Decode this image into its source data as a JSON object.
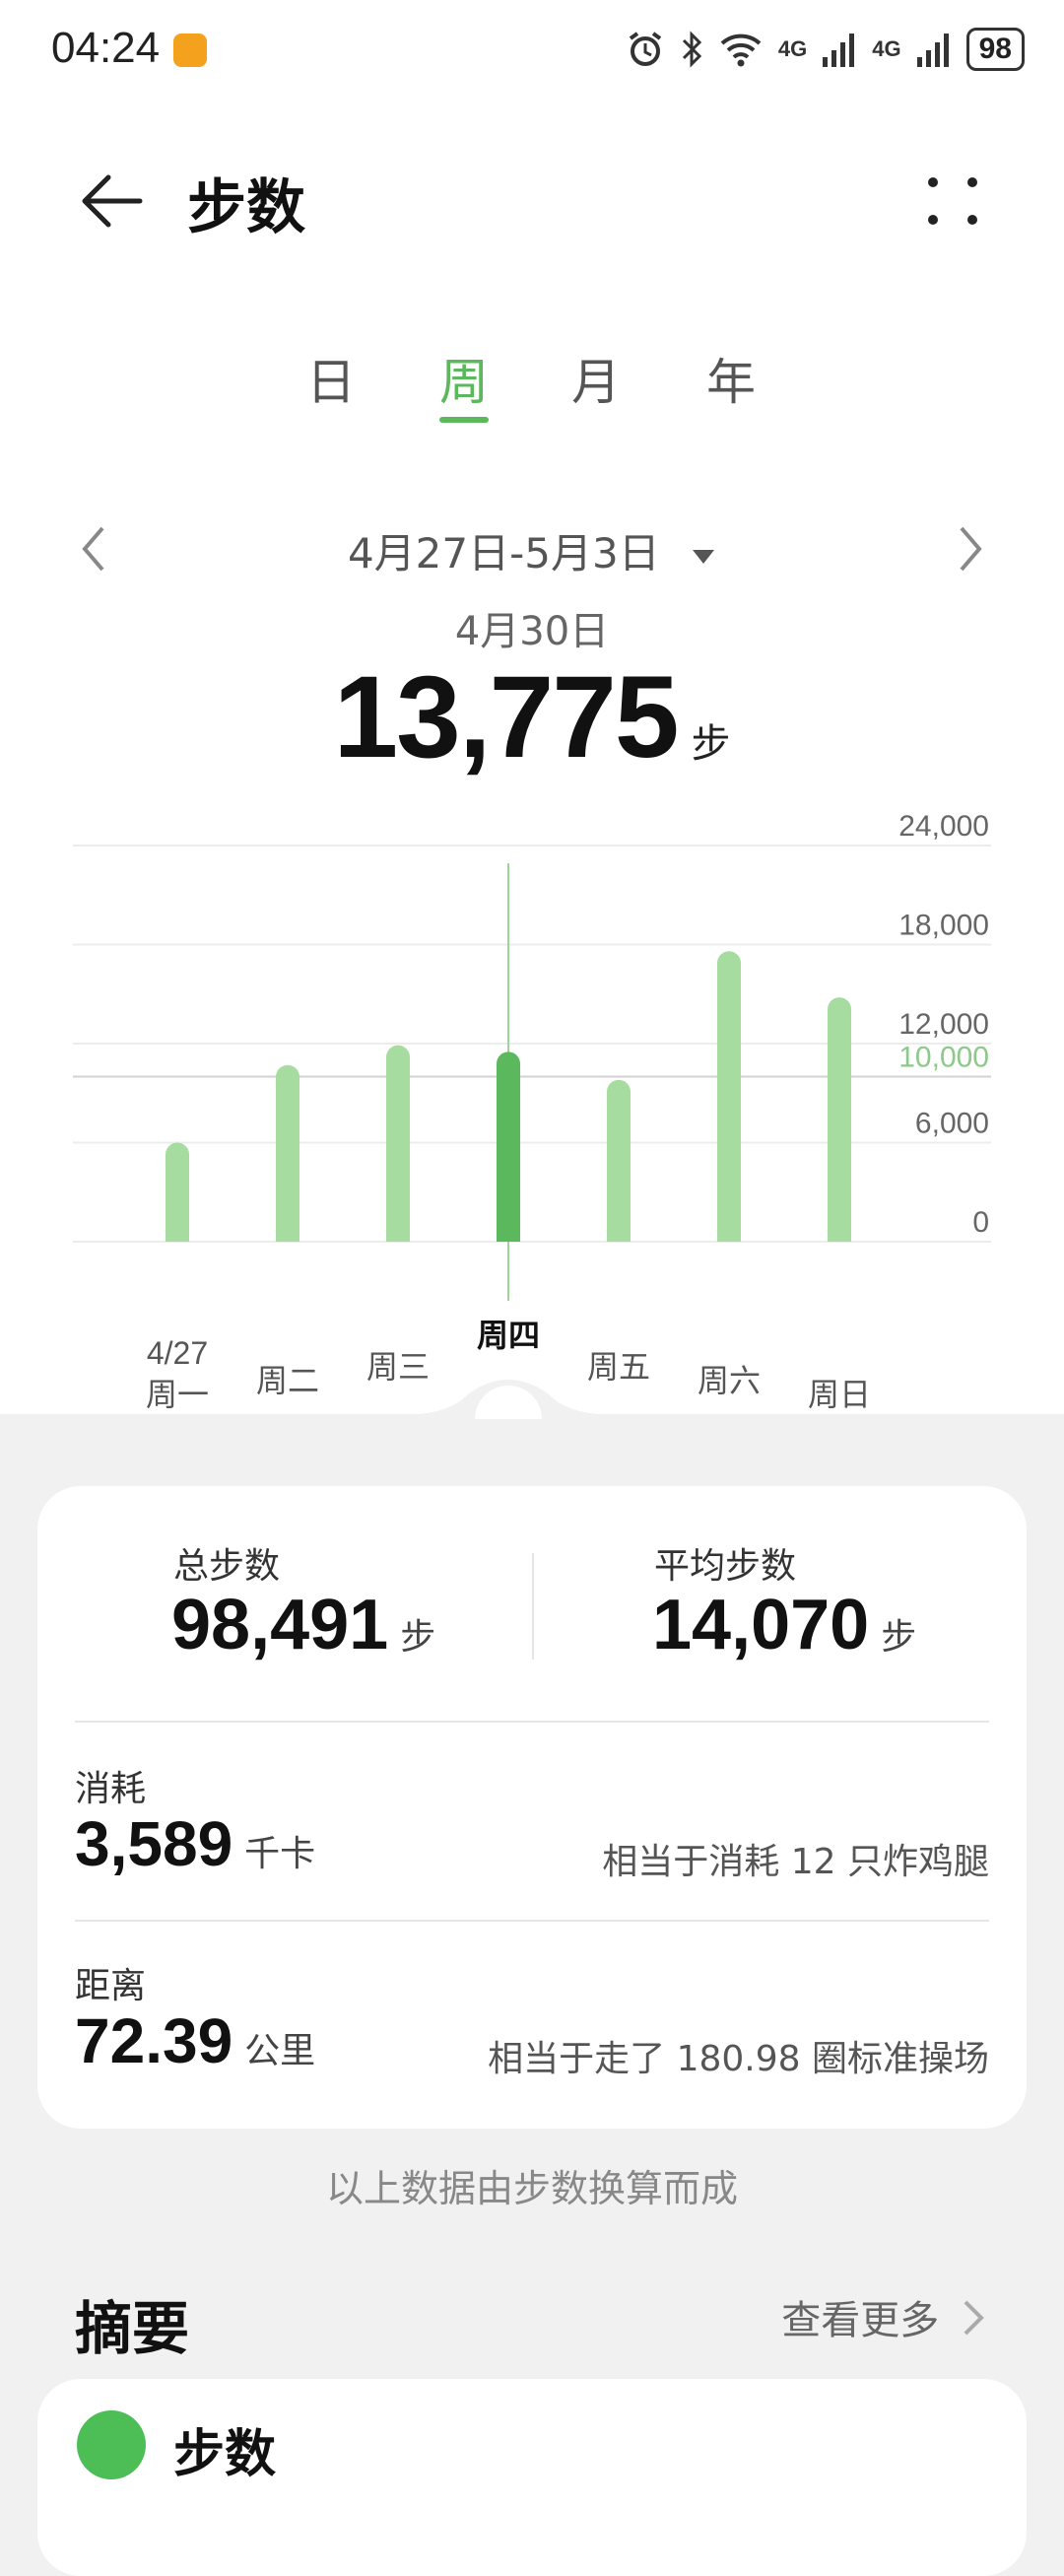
{
  "status": {
    "time": "04:24",
    "battery": "98",
    "net1": "4G",
    "net2": "4G"
  },
  "header": {
    "title": "步数"
  },
  "tabs": [
    {
      "label": "日"
    },
    {
      "label": "周"
    },
    {
      "label": "月"
    },
    {
      "label": "年"
    }
  ],
  "active_tab": 1,
  "range": {
    "label": "4月27日-5月3日"
  },
  "selected": {
    "date": "4月30日",
    "value": "13,775",
    "unit": "步"
  },
  "chart_data": {
    "type": "bar",
    "categories": [
      "周一",
      "周二",
      "周三",
      "周四",
      "周五",
      "周六",
      "周日"
    ],
    "first_date_label": "4/27",
    "values": [
      6000,
      10700,
      11900,
      11500,
      9800,
      17600,
      14800
    ],
    "selected_index": 3,
    "ylim": [
      0,
      24000
    ],
    "y_ticks": [
      "24,000",
      "18,000",
      "12,000",
      "6,000",
      "0"
    ],
    "goal": {
      "value": 10000,
      "label": "10,000"
    },
    "colors": {
      "bar": "#a6dca0",
      "selected": "#5cb85c",
      "goal": "#8cc98a"
    }
  },
  "stats": {
    "total_label": "总步数",
    "total_value": "98,491",
    "total_unit": "步",
    "avg_label": "平均步数",
    "avg_value": "14,070",
    "avg_unit": "步",
    "cal_label": "消耗",
    "cal_value": "3,589",
    "cal_unit": "千卡",
    "cal_note": "相当于消耗 12 只炸鸡腿",
    "dist_label": "距离",
    "dist_value": "72.39",
    "dist_unit": "公里",
    "dist_note": "相当于走了 180.98 圈标准操场"
  },
  "footer_note": "以上数据由步数换算而成",
  "summary": {
    "title": "摘要",
    "more": "查看更多"
  },
  "summary_card": {
    "title": "步数"
  }
}
